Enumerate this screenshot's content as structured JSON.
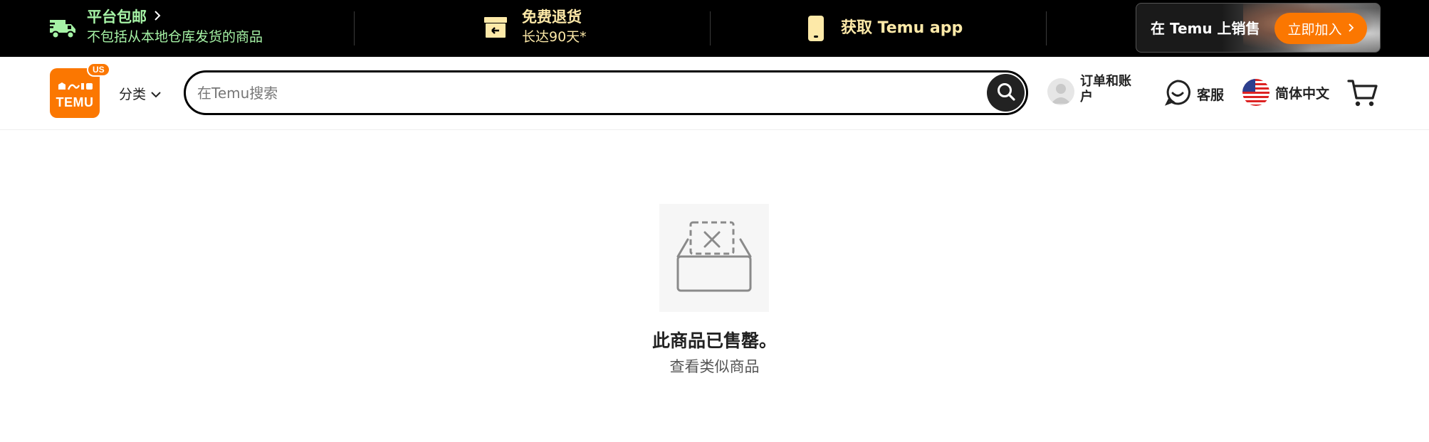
{
  "promo_bar": {
    "free_shipping": {
      "title": "平台包邮",
      "subtitle": "不包括从本地仓库发货的商品",
      "icon": "truck-icon",
      "color": "#a6f3a6"
    },
    "free_returns": {
      "title": "免费退货",
      "subtitle": "长达90天*",
      "icon": "return-box-icon",
      "color": "#fde9a8"
    },
    "get_app": {
      "title": "获取 Temu app",
      "icon": "phone-icon",
      "color": "#fde9a8"
    },
    "seller": {
      "label": "在 Temu 上销售",
      "button": "立即加入"
    }
  },
  "header": {
    "logo": {
      "text": "TEMU",
      "badge": "US",
      "color": "#fb7701"
    },
    "category_label": "分类",
    "search": {
      "placeholder": "在Temu搜索",
      "value": ""
    },
    "account_label": "订单和账户",
    "support_label": "客服",
    "language_label": "简体中文"
  },
  "main": {
    "status": "此商品已售罄。",
    "similar_link": "查看类似商品"
  }
}
